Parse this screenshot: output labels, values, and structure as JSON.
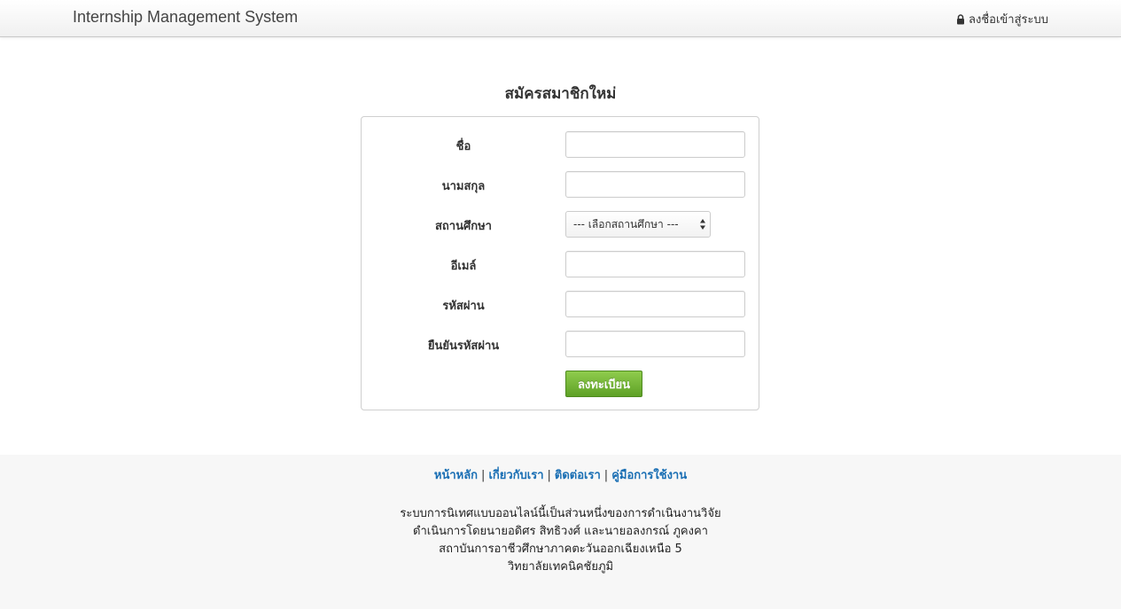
{
  "navbar": {
    "brand": "Internship Management System",
    "login_label": "ลงชื่อเข้าสู่ระบบ",
    "login_icon": "lock-icon"
  },
  "page": {
    "title": "สมัครสมาชิกใหม่"
  },
  "form": {
    "fields": [
      {
        "label": "ชื่อ",
        "value": "",
        "placeholder": ""
      },
      {
        "label": "นามสกุล",
        "value": "",
        "placeholder": ""
      },
      {
        "label": "สถานศึกษา",
        "selected": "--- เลือกสถานศึกษา ---"
      },
      {
        "label": "อีเมล์",
        "value": "",
        "placeholder": ""
      },
      {
        "label": "รหัสผ่าน",
        "value": "",
        "placeholder": ""
      },
      {
        "label": "ยืนยันรหัสผ่าน",
        "value": "",
        "placeholder": ""
      }
    ],
    "submit_label": "ลงทะเบียน",
    "submit_color": "#6aaf2e"
  },
  "footer": {
    "links": [
      "หน้าหลัก",
      "เกี่ยวกับเรา",
      "ติดต่อเรา",
      "คู่มือการใช้งาน"
    ],
    "separator": "|",
    "link_color": "#1a6fb4",
    "lines": [
      "ระบบการนิเทศแบบออนไลน์นี้เป็นส่วนหนึ่งของการดำเนินงานวิจัย",
      "ดำเนินการโดยนายอดิศร สิทธิวงศ์ และนายอลงกรณ์ ภูคงคา",
      "สถาบันการอาชีวศึกษาภาคตะวันออกเฉียงเหนือ 5",
      "วิทยาลัยเทคนิคชัยภูมิ"
    ]
  }
}
